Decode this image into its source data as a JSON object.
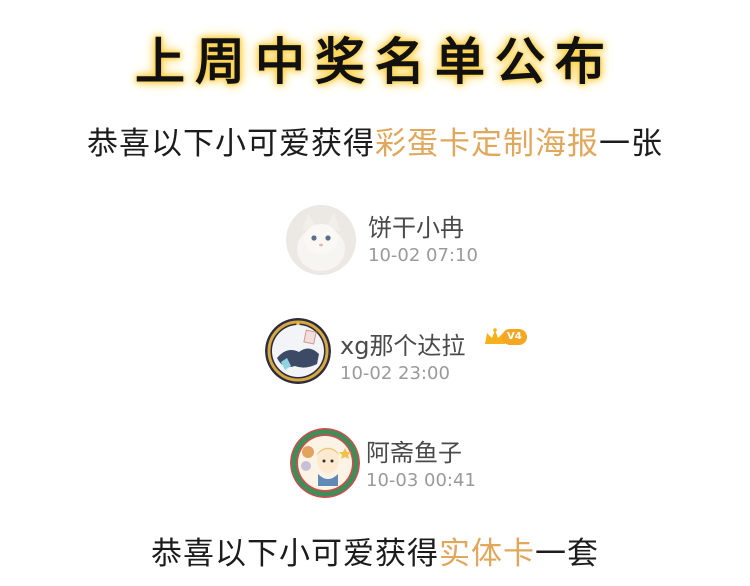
{
  "title": "上周中奖名单公布",
  "line1": {
    "prefix": "恭喜以下小可爱获得",
    "highlight": "彩蛋卡定制海报",
    "suffix": "一张"
  },
  "winners": [
    {
      "name": "饼干小冉",
      "time": "10-02 07:10"
    },
    {
      "name": "xg那个达拉",
      "time": "10-02 23:00",
      "level": "V4"
    },
    {
      "name": "阿斋鱼子",
      "time": "10-03 00:41"
    }
  ],
  "line2": {
    "prefix": "恭喜以下小可爱获得",
    "highlight": "实体卡",
    "suffix": "一套"
  },
  "colors": {
    "highlight": "#e0a85c",
    "title_glow": "#ffd24d",
    "level_badge": "#f5a623"
  }
}
